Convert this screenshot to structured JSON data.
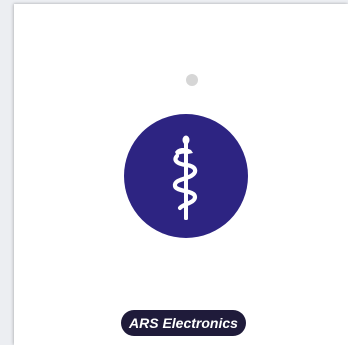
{
  "brand": {
    "label": "ARS Electronics"
  },
  "emblem": {
    "icon": "rod-of-asclepius-icon",
    "background_color": "#2d2482",
    "symbol_color": "#ffffff"
  },
  "indicator": {
    "color": "#d6d6d6"
  }
}
